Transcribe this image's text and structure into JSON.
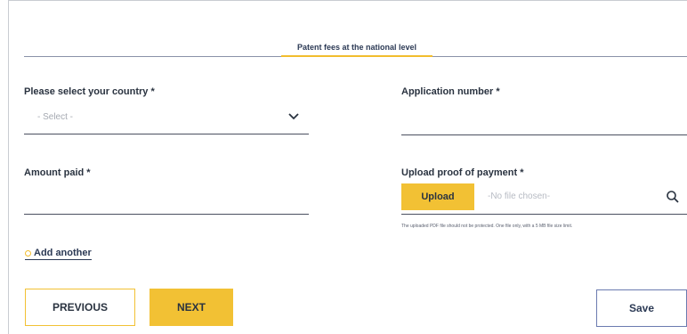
{
  "tabs": {
    "active_label": "Patent fees at the national level"
  },
  "form": {
    "country_label": "Please select your country *",
    "country_value": "- Select -",
    "application_number_label": "Application number  *",
    "amount_paid_label": "Amount paid  *",
    "upload_label": "Upload proof of payment  *",
    "upload_button": "Upload",
    "file_chosen": "-No file chosen-",
    "upload_hint": "The uploaded PDF file should not be protected. One file only, with a 5 MB file size limit.",
    "add_another": "Add another"
  },
  "actions": {
    "previous": "PREVIOUS",
    "next": "NEXT",
    "save": "Save"
  },
  "colors": {
    "accent": "#f2c134",
    "text": "#2a3340",
    "outline": "#6b7bb0"
  }
}
